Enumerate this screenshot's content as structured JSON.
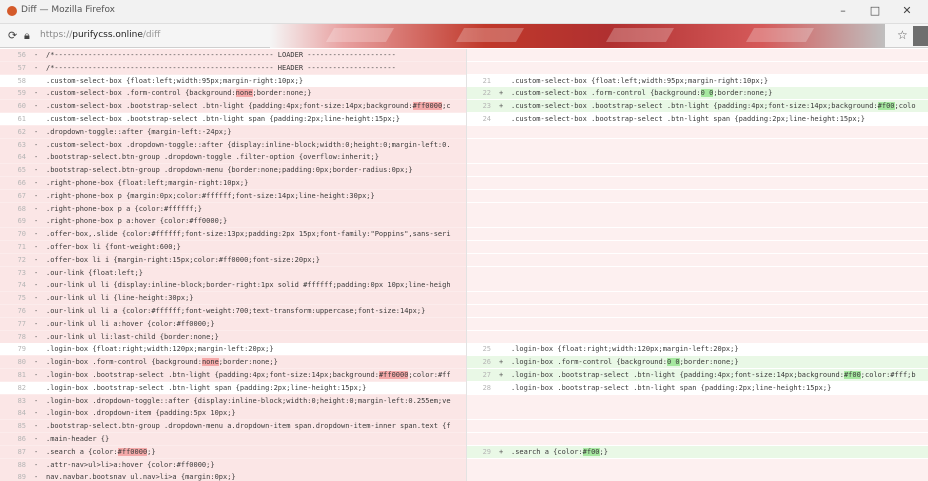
{
  "window": {
    "title": "Diff — Mozilla Firefox",
    "minimize": "–",
    "maximize": "□",
    "close": "✕"
  },
  "nav": {
    "url_scheme": "https://",
    "url_domain": "purifycss.online",
    "url_path": "/diff",
    "star": "☆"
  },
  "left_rows": [
    {
      "ln": "56",
      "sign": "-",
      "type": "removed",
      "code": "/*---------------------------------------------------- LOADER ---------------------"
    },
    {
      "ln": "57",
      "sign": "-",
      "type": "removed",
      "code": "/*---------------------------------------------------- HEADER ---------------------"
    },
    {
      "ln": "58",
      "sign": " ",
      "type": "context",
      "code": ".custom-select-box {float:left;width:95px;margin-right:10px;}"
    },
    {
      "ln": "59",
      "sign": "-",
      "type": "removed",
      "code": ".custom-select-box .form-control {background:",
      "hl": "none",
      "tail": ";border:none;}"
    },
    {
      "ln": "60",
      "sign": "-",
      "type": "removed",
      "code": ".custom-select-box .bootstrap-select .btn-light {padding:4px;font-size:14px;background:",
      "hl": "#ff0000",
      "tail": ";c"
    },
    {
      "ln": "61",
      "sign": " ",
      "type": "context",
      "code": ".custom-select-box .bootstrap-select .btn-light span {padding:2px;line-height:15px;}"
    },
    {
      "ln": "62",
      "sign": "-",
      "type": "removed",
      "code": ".dropdown-toggle::after {margin-left:-24px;}"
    },
    {
      "ln": "63",
      "sign": "-",
      "type": "removed",
      "code": ".custom-select-box .dropdown-toggle::after {display:inline-block;width:0;height:0;margin-left:0."
    },
    {
      "ln": "64",
      "sign": "-",
      "type": "removed",
      "code": ".bootstrap-select.btn-group .dropdown-toggle .filter-option {overflow:inherit;}"
    },
    {
      "ln": "65",
      "sign": "-",
      "type": "removed",
      "code": ".bootstrap-select.btn-group .dropdown-menu {border:none;padding:0px;border-radius:0px;}"
    },
    {
      "ln": "66",
      "sign": "-",
      "type": "removed",
      "code": ".right-phone-box {float:left;margin-right:10px;}"
    },
    {
      "ln": "67",
      "sign": "-",
      "type": "removed",
      "code": ".right-phone-box p {margin:0px;color:#ffffff;font-size:14px;line-height:30px;}"
    },
    {
      "ln": "68",
      "sign": "-",
      "type": "removed",
      "code": ".right-phone-box p a {color:#ffffff;}"
    },
    {
      "ln": "69",
      "sign": "-",
      "type": "removed",
      "code": ".right-phone-box p a:hover {color:#ff0000;}"
    },
    {
      "ln": "70",
      "sign": "-",
      "type": "removed",
      "code": ".offer-box,.slide {color:#ffffff;font-size:13px;padding:2px 15px;font-family:\"Poppins\",sans-seri"
    },
    {
      "ln": "71",
      "sign": "-",
      "type": "removed",
      "code": ".offer-box li {font-weight:600;}"
    },
    {
      "ln": "72",
      "sign": "-",
      "type": "removed",
      "code": ".offer-box li i {margin-right:15px;color:#ff0000;font-size:20px;}"
    },
    {
      "ln": "73",
      "sign": "-",
      "type": "removed",
      "code": ".our-link {float:left;}"
    },
    {
      "ln": "74",
      "sign": "-",
      "type": "removed",
      "code": ".our-link ul li {display:inline-block;border-right:1px solid #ffffff;padding:0px 10px;line-heigh"
    },
    {
      "ln": "75",
      "sign": "-",
      "type": "removed",
      "code": ".our-link ul li {line-height:30px;}"
    },
    {
      "ln": "76",
      "sign": "-",
      "type": "removed",
      "code": ".our-link ul li a {color:#ffffff;font-weight:700;text-transform:uppercase;font-size:14px;}"
    },
    {
      "ln": "77",
      "sign": "-",
      "type": "removed",
      "code": ".our-link ul li a:hover {color:#ff0000;}"
    },
    {
      "ln": "78",
      "sign": "-",
      "type": "removed",
      "code": ".our-link ul li:last-child {border:none;}"
    },
    {
      "ln": "79",
      "sign": " ",
      "type": "context",
      "code": ".login-box {float:right;width:120px;margin-left:20px;}"
    },
    {
      "ln": "80",
      "sign": "-",
      "type": "removed",
      "code": ".login-box .form-control {background:",
      "hl": "none",
      "tail": ";border:none;}"
    },
    {
      "ln": "81",
      "sign": "-",
      "type": "removed",
      "code": ".login-box .bootstrap-select .btn-light {padding:4px;font-size:14px;background:",
      "hl": "#ff0000",
      "tail": ";color:#ff"
    },
    {
      "ln": "82",
      "sign": " ",
      "type": "context",
      "code": ".login-box .bootstrap-select .btn-light span {padding:2px;line-height:15px;}"
    },
    {
      "ln": "83",
      "sign": "-",
      "type": "removed",
      "code": ".login-box .dropdown-toggle::after {display:inline-block;width:0;height:0;margin-left:0.255em;ve"
    },
    {
      "ln": "84",
      "sign": "-",
      "type": "removed",
      "code": ".login-box .dropdown-item {padding:5px 10px;}"
    },
    {
      "ln": "85",
      "sign": "-",
      "type": "removed",
      "code": ".bootstrap-select.btn-group .dropdown-menu a.dropdown-item span.dropdown-item-inner span.text {f"
    },
    {
      "ln": "86",
      "sign": "-",
      "type": "removed",
      "code": ".main-header {}"
    },
    {
      "ln": "87",
      "sign": "-",
      "type": "removed",
      "code": ".search a {color:",
      "hl": "#ff0000",
      "tail": ";}"
    },
    {
      "ln": "88",
      "sign": "-",
      "type": "removed",
      "code": ".attr-nav>ul>li>a:hover {color:#ff0000;}"
    },
    {
      "ln": "89",
      "sign": "-",
      "type": "removed",
      "code": "nav.navbar.bootsnav ul.nav>li>a {margin:0px;}"
    }
  ],
  "right_rows": [
    {
      "ln": "",
      "sign": "",
      "type": "empty",
      "code": ""
    },
    {
      "ln": "",
      "sign": "",
      "type": "empty",
      "code": ""
    },
    {
      "ln": "21",
      "sign": " ",
      "type": "context",
      "code": ".custom-select-box {float:left;width:95px;margin-right:10px;}"
    },
    {
      "ln": "22",
      "sign": "+",
      "type": "added",
      "code": ".custom-select-box .form-control {background:",
      "hl": "0 0",
      "tail": ";border:none;}"
    },
    {
      "ln": "23",
      "sign": "+",
      "type": "added",
      "code": ".custom-select-box .bootstrap-select .btn-light {padding:4px;font-size:14px;background:",
      "hl": "#f00",
      "tail": ";colo"
    },
    {
      "ln": "24",
      "sign": " ",
      "type": "context",
      "code": ".custom-select-box .bootstrap-select .btn-light span {padding:2px;line-height:15px;}"
    },
    {
      "ln": "",
      "sign": "",
      "type": "empty",
      "code": ""
    },
    {
      "ln": "",
      "sign": "",
      "type": "empty",
      "code": ""
    },
    {
      "ln": "",
      "sign": "",
      "type": "empty",
      "code": ""
    },
    {
      "ln": "",
      "sign": "",
      "type": "empty",
      "code": ""
    },
    {
      "ln": "",
      "sign": "",
      "type": "empty",
      "code": ""
    },
    {
      "ln": "",
      "sign": "",
      "type": "empty",
      "code": ""
    },
    {
      "ln": "",
      "sign": "",
      "type": "empty",
      "code": ""
    },
    {
      "ln": "",
      "sign": "",
      "type": "empty",
      "code": ""
    },
    {
      "ln": "",
      "sign": "",
      "type": "empty",
      "code": ""
    },
    {
      "ln": "",
      "sign": "",
      "type": "empty",
      "code": ""
    },
    {
      "ln": "",
      "sign": "",
      "type": "empty",
      "code": ""
    },
    {
      "ln": "",
      "sign": "",
      "type": "empty",
      "code": ""
    },
    {
      "ln": "",
      "sign": "",
      "type": "empty",
      "code": ""
    },
    {
      "ln": "",
      "sign": "",
      "type": "empty",
      "code": ""
    },
    {
      "ln": "",
      "sign": "",
      "type": "empty",
      "code": ""
    },
    {
      "ln": "",
      "sign": "",
      "type": "empty",
      "code": ""
    },
    {
      "ln": "",
      "sign": "",
      "type": "empty",
      "code": ""
    },
    {
      "ln": "25",
      "sign": " ",
      "type": "context",
      "code": ".login-box {float:right;width:120px;margin-left:20px;}"
    },
    {
      "ln": "26",
      "sign": "+",
      "type": "added",
      "code": ".login-box .form-control {background:",
      "hl": "0 0",
      "tail": ";border:none;}"
    },
    {
      "ln": "27",
      "sign": "+",
      "type": "added",
      "code": ".login-box .bootstrap-select .btn-light {padding:4px;font-size:14px;background:",
      "hl": "#f00",
      "tail": ";color:#fff;b"
    },
    {
      "ln": "28",
      "sign": " ",
      "type": "context",
      "code": ".login-box .bootstrap-select .btn-light span {padding:2px;line-height:15px;}"
    },
    {
      "ln": "",
      "sign": "",
      "type": "empty",
      "code": ""
    },
    {
      "ln": "",
      "sign": "",
      "type": "empty",
      "code": ""
    },
    {
      "ln": "",
      "sign": "",
      "type": "empty",
      "code": ""
    },
    {
      "ln": "",
      "sign": "",
      "type": "empty",
      "code": ""
    },
    {
      "ln": "29",
      "sign": "+",
      "type": "added",
      "code": ".search a {color:",
      "hl": "#f00",
      "tail": ";}"
    },
    {
      "ln": "",
      "sign": "",
      "type": "empty",
      "code": ""
    },
    {
      "ln": "",
      "sign": "",
      "type": "empty",
      "code": ""
    }
  ]
}
